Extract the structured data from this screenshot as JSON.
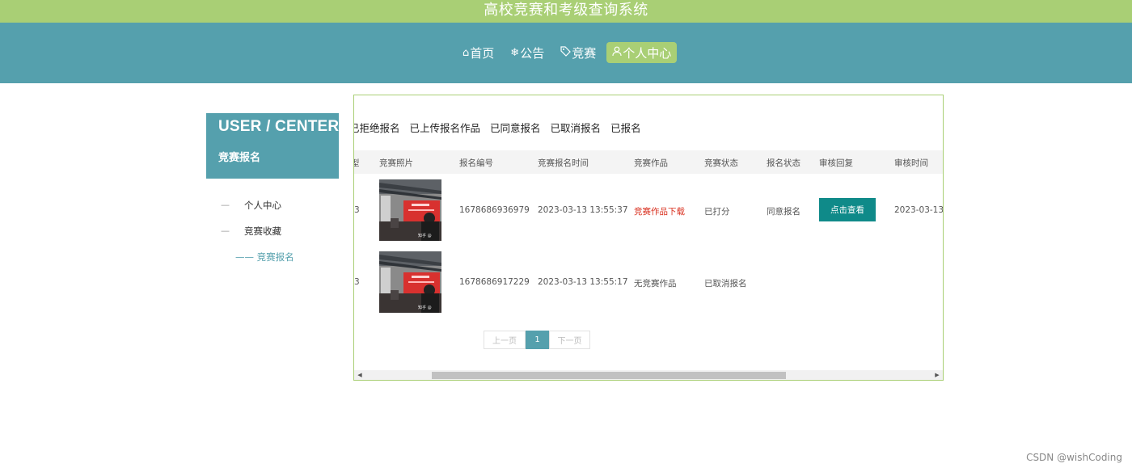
{
  "header": {
    "title": "高校竞赛和考级查询系统"
  },
  "nav": {
    "items": [
      {
        "icon": "home-icon",
        "glyph": "⌂",
        "label": "首页"
      },
      {
        "icon": "notice-icon",
        "glyph": "❄",
        "label": "公告"
      },
      {
        "icon": "tag-icon",
        "glyph": "⌨",
        "label": "竞赛"
      },
      {
        "icon": "user-icon",
        "glyph": "♙",
        "label": "个人中心",
        "active": true
      }
    ]
  },
  "sidebar": {
    "heading_en": "USER / CENTER",
    "heading_cn": "竞赛报名",
    "menu": [
      {
        "dash": "—",
        "label": "个人中心"
      },
      {
        "dash": "—",
        "label": "竞赛收藏"
      }
    ],
    "submenu": {
      "label": "—— 竞赛报名"
    }
  },
  "tabs": [
    "已拒绝报名",
    "已上传报名作品",
    "已同意报名",
    "已取消报名",
    "已报名"
  ],
  "table": {
    "headers": [
      "竞赛照片",
      "报名编号",
      "竞赛报名时间",
      "竞赛作品",
      "竞赛状态",
      "报名状态",
      "审核回复",
      "审核时间"
    ],
    "rows": [
      {
        "partial": "3",
        "reg_no": "1678686936979",
        "reg_time": "2023-03-13 13:55:37",
        "work": "竞赛作品下载",
        "work_is_link": true,
        "contest_status": "已打分",
        "reg_status": "同意报名",
        "review_button": "点击查看",
        "review_time": "2023-03-13 1"
      },
      {
        "partial": "3",
        "reg_no": "1678686917229",
        "reg_time": "2023-03-13 13:55:17",
        "work": "无竞赛作品",
        "work_is_link": false,
        "contest_status": "已取消报名",
        "reg_status": "",
        "review_button": "",
        "review_time": ""
      }
    ]
  },
  "pagination": {
    "prev": "上一页",
    "current": "1",
    "next": "下一页"
  },
  "colors": {
    "green": "#a9cf75",
    "teal": "#55a0ad",
    "button": "#0f8a89",
    "link_red": "#d9301f"
  },
  "watermark": "CSDN @wishCoding"
}
